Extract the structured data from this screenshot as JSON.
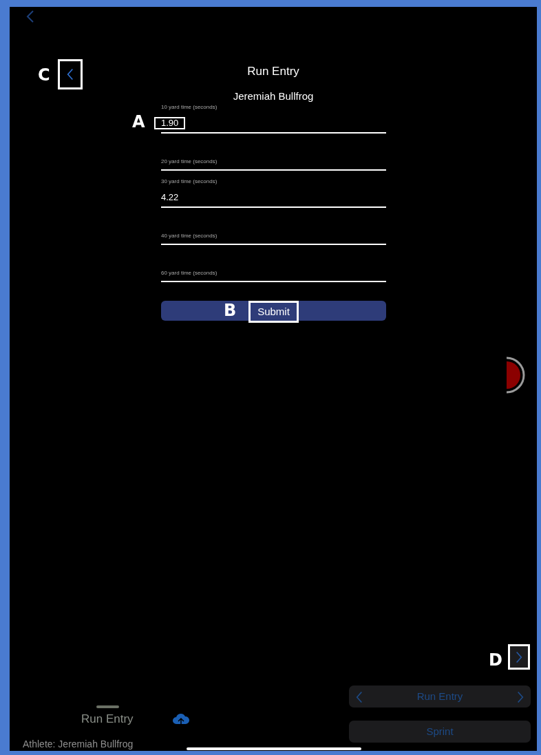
{
  "screen": {
    "title": "Run Entry",
    "athlete_name": "Jeremiah Bullfrog"
  },
  "back_button": {
    "annotation": "C"
  },
  "fields": [
    {
      "label": "10 yard time (seconds)",
      "value": "1.90",
      "annotation": "A"
    },
    {
      "label": "20 yard time (seconds)"
    },
    {
      "label": "30 yard time (seconds)",
      "value": "4.22"
    },
    {
      "label": "40 yard time (seconds)"
    },
    {
      "label": "60 yard time (seconds)"
    }
  ],
  "submit": {
    "label": "Submit",
    "annotation": "B"
  },
  "next_button": {
    "annotation": "D"
  },
  "section_picker": {
    "label": "Run Entry"
  },
  "mode_button": {
    "label": "Sprint"
  },
  "bottom_tab": {
    "label": "Run Entry"
  },
  "status": "Athlete: Jeremiah Bullfrog"
}
